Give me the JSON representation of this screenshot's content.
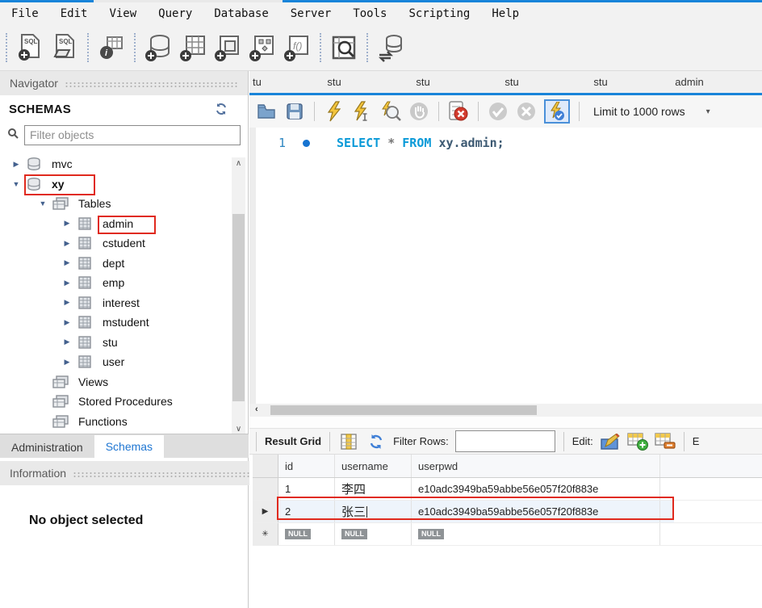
{
  "colors": {
    "accent": "#1884d9",
    "annotation": "#e02a1e",
    "keyword_blue": "#0b9ad8",
    "active_tab_blue": "#1f76d2",
    "selection": "#eef4fb"
  },
  "menu": {
    "items": [
      "File",
      "Edit",
      "View",
      "Query",
      "Database",
      "Server",
      "Tools",
      "Scripting",
      "Help"
    ]
  },
  "main_toolbar": {
    "icon_names": [
      "new-sql-tab-icon",
      "open-sql-script-icon",
      "table-inspector-icon",
      "create-schema-icon",
      "create-table-icon",
      "create-view-icon",
      "create-procedure-icon",
      "create-function-icon",
      "search-table-data-icon",
      "reconnect-database-icon"
    ]
  },
  "sidebar": {
    "navigator_title": "Navigator",
    "schemas_header": "SCHEMAS",
    "refresh_icon": "refresh-schemas-icon",
    "filter_placeholder": "Filter objects",
    "tree": [
      {
        "label": "mvc"
      },
      {
        "label": "xy"
      },
      {
        "label": "Tables"
      },
      {
        "label": "admin"
      },
      {
        "label": "cstudent"
      },
      {
        "label": "dept"
      },
      {
        "label": "emp"
      },
      {
        "label": "interest"
      },
      {
        "label": "mstudent"
      },
      {
        "label": "stu"
      },
      {
        "label": "user"
      },
      {
        "label": "Views"
      },
      {
        "label": "Stored Procedures"
      },
      {
        "label": "Functions"
      }
    ],
    "tabs": [
      {
        "label": "Administration"
      },
      {
        "label": "Schemas"
      }
    ],
    "information_title": "Information",
    "empty_text": "No object selected"
  },
  "editor": {
    "tabs": [
      "tu",
      "stu",
      "stu",
      "stu",
      "stu",
      "admin"
    ],
    "toolbar": {
      "limit_label": "Limit to 1000 rows"
    },
    "code": {
      "line_number": "1",
      "kw1": "SELECT",
      "star": "*",
      "kw2": "FROM",
      "obj": "xy.admin;"
    }
  },
  "result": {
    "toolbar": {
      "title": "Result Grid",
      "filter_label": "Filter Rows:",
      "filter_value": "",
      "edit_label": "Edit:",
      "export_label_truncated": "E"
    },
    "grid": {
      "columns": [
        "id",
        "username",
        "userpwd"
      ],
      "rows": [
        {
          "id": "1",
          "username": "李四",
          "userpwd": "e10adc3949ba59abbe56e057f20f883e"
        },
        {
          "id": "2",
          "username": "张三",
          "userpwd": "e10adc3949ba59abbe56e057f20f883e"
        }
      ],
      "null_row": [
        "NULL",
        "NULL",
        "NULL"
      ],
      "selected_row_index": 1
    }
  },
  "scroll": {
    "up_glyph": "∧",
    "down_glyph": "∨",
    "left_glyph": "‹"
  }
}
